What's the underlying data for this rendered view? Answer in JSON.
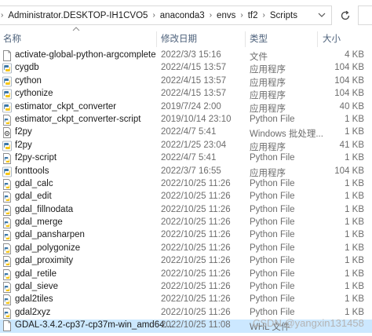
{
  "address": {
    "crumbs": [
      "Administrator.DESKTOP-IH1CVO5",
      "anaconda3",
      "envs",
      "tf2",
      "Scripts"
    ],
    "refresh_icon": "refresh-icon"
  },
  "columns": {
    "name": "名称",
    "date": "修改日期",
    "type": "类型",
    "size": "大小"
  },
  "files": [
    {
      "name": "activate-global-python-argcomplete",
      "date": "2022/3/3 15:16",
      "type": "文件",
      "size": "4 KB",
      "icon": "file"
    },
    {
      "name": "cygdb",
      "date": "2022/4/15 13:57",
      "type": "应用程序",
      "size": "104 KB",
      "icon": "python-exe"
    },
    {
      "name": "cython",
      "date": "2022/4/15 13:57",
      "type": "应用程序",
      "size": "104 KB",
      "icon": "python-exe"
    },
    {
      "name": "cythonize",
      "date": "2022/4/15 13:57",
      "type": "应用程序",
      "size": "104 KB",
      "icon": "python-exe"
    },
    {
      "name": "estimator_ckpt_converter",
      "date": "2019/7/24 2:00",
      "type": "应用程序",
      "size": "40 KB",
      "icon": "python-exe"
    },
    {
      "name": "estimator_ckpt_converter-script",
      "date": "2019/10/14 23:10",
      "type": "Python File",
      "size": "1 KB",
      "icon": "python-file"
    },
    {
      "name": "f2py",
      "date": "2022/4/7 5:41",
      "type": "Windows 批处理...",
      "size": "1 KB",
      "icon": "batch"
    },
    {
      "name": "f2py",
      "date": "2022/1/25 23:04",
      "type": "应用程序",
      "size": "41 KB",
      "icon": "python-exe"
    },
    {
      "name": "f2py-script",
      "date": "2022/4/7 5:41",
      "type": "Python File",
      "size": "1 KB",
      "icon": "python-file"
    },
    {
      "name": "fonttools",
      "date": "2022/3/7 16:55",
      "type": "应用程序",
      "size": "104 KB",
      "icon": "python-exe"
    },
    {
      "name": "gdal_calc",
      "date": "2022/10/25 11:26",
      "type": "Python File",
      "size": "1 KB",
      "icon": "python-file"
    },
    {
      "name": "gdal_edit",
      "date": "2022/10/25 11:26",
      "type": "Python File",
      "size": "1 KB",
      "icon": "python-file"
    },
    {
      "name": "gdal_fillnodata",
      "date": "2022/10/25 11:26",
      "type": "Python File",
      "size": "1 KB",
      "icon": "python-file"
    },
    {
      "name": "gdal_merge",
      "date": "2022/10/25 11:26",
      "type": "Python File",
      "size": "1 KB",
      "icon": "python-file"
    },
    {
      "name": "gdal_pansharpen",
      "date": "2022/10/25 11:26",
      "type": "Python File",
      "size": "1 KB",
      "icon": "python-file"
    },
    {
      "name": "gdal_polygonize",
      "date": "2022/10/25 11:26",
      "type": "Python File",
      "size": "1 KB",
      "icon": "python-file"
    },
    {
      "name": "gdal_proximity",
      "date": "2022/10/25 11:26",
      "type": "Python File",
      "size": "1 KB",
      "icon": "python-file"
    },
    {
      "name": "gdal_retile",
      "date": "2022/10/25 11:26",
      "type": "Python File",
      "size": "1 KB",
      "icon": "python-file"
    },
    {
      "name": "gdal_sieve",
      "date": "2022/10/25 11:26",
      "type": "Python File",
      "size": "1 KB",
      "icon": "python-file"
    },
    {
      "name": "gdal2tiles",
      "date": "2022/10/25 11:26",
      "type": "Python File",
      "size": "1 KB",
      "icon": "python-file"
    },
    {
      "name": "gdal2xyz",
      "date": "2022/10/25 11:26",
      "type": "Python File",
      "size": "1 KB",
      "icon": "python-file"
    },
    {
      "name": "GDAL-3.4.2-cp37-cp37m-win_amd64....",
      "date": "2022/10/25 11:08",
      "type": "WHL 文件",
      "size": "",
      "icon": "file",
      "selected": true
    }
  ],
  "watermark": "CSDN @yangxin131458",
  "colors": {
    "header_text": "#4c607a",
    "secondary_text": "#6d6d6d",
    "selection": "#cce8ff",
    "python_blue": "#3b77a8",
    "python_yellow": "#f5c518"
  }
}
